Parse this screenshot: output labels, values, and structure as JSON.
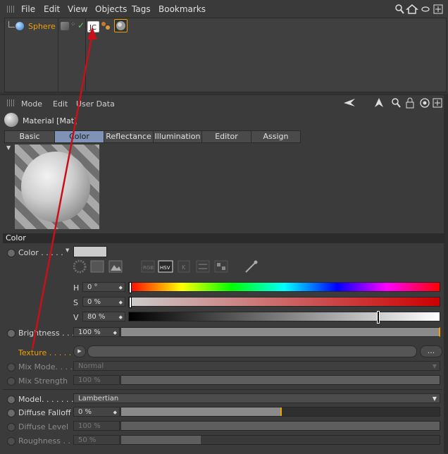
{
  "menu": [
    "File",
    "Edit",
    "View",
    "Objects",
    "Tags",
    "Bookmarks"
  ],
  "object_list": {
    "name": "Sphere"
  },
  "attr_menu": [
    "Mode",
    "Edit",
    "User Data"
  ],
  "material": {
    "title": "Material [Mat]"
  },
  "tabs": [
    {
      "label": "Basic",
      "active": false
    },
    {
      "label": "Color",
      "active": true
    },
    {
      "label": "Reflectance",
      "active": false
    },
    {
      "label": "Illumination",
      "active": false
    },
    {
      "label": "Editor",
      "active": false
    },
    {
      "label": "Assign",
      "active": false
    }
  ],
  "section": {
    "title": "Color"
  },
  "color": {
    "label": "Color . . . . .",
    "mode_buttons": [
      "RGB",
      "HSV",
      "K"
    ],
    "h": "0 °",
    "s": "0 %",
    "v": "80 %",
    "h_label": "H",
    "s_label": "S",
    "v_label": "V"
  },
  "brightness": {
    "label": "Brightness . . .",
    "value": "100 %"
  },
  "texture": {
    "label": "Texture . . . . . . .",
    "button": "..."
  },
  "mix_mode": {
    "label": "Mix Mode. . . .",
    "value": "Normal"
  },
  "mix_strength": {
    "label": "Mix Strength",
    "value": "100 %"
  },
  "model": {
    "label": "Model. . . . . . . .",
    "value": "Lambertian"
  },
  "diffuse_falloff": {
    "label": "Diffuse Falloff",
    "value": "0 %"
  },
  "diffuse_level": {
    "label": "Diffuse Level",
    "value": "100 %"
  },
  "roughness": {
    "label": "Roughness . . .",
    "value": "50 %"
  },
  "colors": {
    "accent": "#f0a000",
    "active_tab": "#7f93b6",
    "arrow": "#c8101a"
  }
}
